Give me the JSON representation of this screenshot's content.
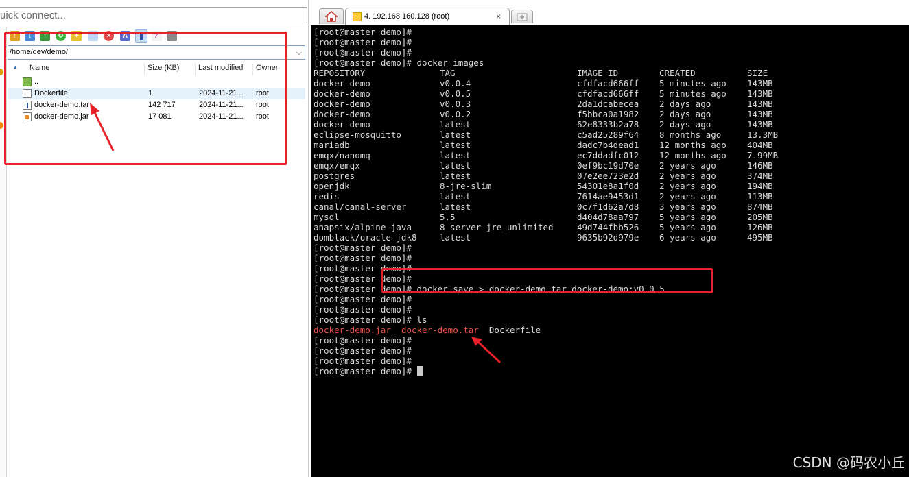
{
  "quick_connect": {
    "placeholder": "uick connect..."
  },
  "sftp": {
    "path": "/home/dev/demo/",
    "columns": {
      "name": "Name",
      "size": "Size (KB)",
      "modified": "Last modified",
      "owner": "Owner"
    },
    "parent_label": "..",
    "files": [
      {
        "name": "Dockerfile",
        "size": "1",
        "modified": "2024-11-21...",
        "owner": "root",
        "icon": "file-icon"
      },
      {
        "name": "docker-demo.tar",
        "size": "142 717",
        "modified": "2024-11-21...",
        "owner": "root",
        "icon": "archive-icon"
      },
      {
        "name": "docker-demo.jar",
        "size": "17 081",
        "modified": "2024-11-21...",
        "owner": "root",
        "icon": "java-icon"
      }
    ]
  },
  "tabs": {
    "session_label": "4. 192.168.160.128 (root)",
    "close": "×"
  },
  "terminal": {
    "lines": [
      {
        "prompt": "[root@master demo]#",
        "cmd": ""
      },
      {
        "prompt": "[root@master demo]#",
        "cmd": ""
      },
      {
        "prompt": "[root@master demo]#",
        "cmd": ""
      },
      {
        "prompt": "[root@master demo]#",
        "cmd": " docker images"
      }
    ],
    "images_header": [
      "REPOSITORY",
      "TAG",
      "IMAGE ID",
      "CREATED",
      "SIZE"
    ],
    "images": [
      [
        "docker-demo",
        "v0.0.4",
        "cfdfacd666ff",
        "5 minutes ago",
        "143MB"
      ],
      [
        "docker-demo",
        "v0.0.5",
        "cfdfacd666ff",
        "5 minutes ago",
        "143MB"
      ],
      [
        "docker-demo",
        "v0.0.3",
        "2da1dcabecea",
        "2 days ago",
        "143MB"
      ],
      [
        "docker-demo",
        "v0.0.2",
        "f5bbca0a1982",
        "2 days ago",
        "143MB"
      ],
      [
        "docker-demo",
        "latest",
        "62e8333b2a78",
        "2 days ago",
        "143MB"
      ],
      [
        "eclipse-mosquitto",
        "latest",
        "c5ad25289f64",
        "8 months ago",
        "13.3MB"
      ],
      [
        "mariadb",
        "latest",
        "dadc7b4dead1",
        "12 months ago",
        "404MB"
      ],
      [
        "emqx/nanomq",
        "latest",
        "ec7ddadfc012",
        "12 months ago",
        "7.99MB"
      ],
      [
        "emqx/emqx",
        "latest",
        "0ef9bc19d70e",
        "2 years ago",
        "146MB"
      ],
      [
        "postgres",
        "latest",
        "07e2ee723e2d",
        "2 years ago",
        "374MB"
      ],
      [
        "openjdk",
        "8-jre-slim",
        "54301e8a1f0d",
        "2 years ago",
        "194MB"
      ],
      [
        "redis",
        "latest",
        "7614ae9453d1",
        "2 years ago",
        "113MB"
      ],
      [
        "canal/canal-server",
        "latest",
        "0c7f1d62a7d8",
        "3 years ago",
        "874MB"
      ],
      [
        "mysql",
        "5.5",
        "d404d78aa797",
        "5 years ago",
        "205MB"
      ],
      [
        "anapsix/alpine-java",
        "8_server-jre_unlimited",
        "49d744fbb526",
        "5 years ago",
        "126MB"
      ],
      [
        "domblack/oracle-jdk8",
        "latest",
        "9635b92d979e",
        "6 years ago",
        "495MB"
      ]
    ],
    "after": [
      {
        "prompt": "[root@master demo]#",
        "cmd": ""
      },
      {
        "prompt": "[root@master demo]#",
        "cmd": ""
      },
      {
        "prompt": "[root@master demo]#",
        "cmd": ""
      },
      {
        "prompt": "[root@master demo]#",
        "cmd": ""
      },
      {
        "prompt": "[root@master demo]#",
        "cmd": " docker save > docker-demo.tar docker-demo:v0.0.5"
      },
      {
        "prompt": "[root@master demo]#",
        "cmd": ""
      },
      {
        "prompt": "[root@master demo]#",
        "cmd": ""
      },
      {
        "prompt": "[root@master demo]#",
        "cmd": " ls"
      }
    ],
    "ls_output": {
      "jar": "docker-demo.jar",
      "tar": "docker-demo.tar",
      "dockerfile": "Dockerfile"
    },
    "tail": [
      {
        "prompt": "[root@master demo]#",
        "cmd": ""
      },
      {
        "prompt": "[root@master demo]#",
        "cmd": ""
      },
      {
        "prompt": "[root@master demo]#",
        "cmd": ""
      },
      {
        "prompt": "[root@master demo]#",
        "cmd": " "
      }
    ]
  },
  "watermark": "CSDN @码农小丘",
  "colors": {
    "annotation_red": "#e8202a",
    "terminal_bg": "#000000",
    "terminal_fg": "#d8d8d8",
    "ls_red": "#e8504a"
  }
}
